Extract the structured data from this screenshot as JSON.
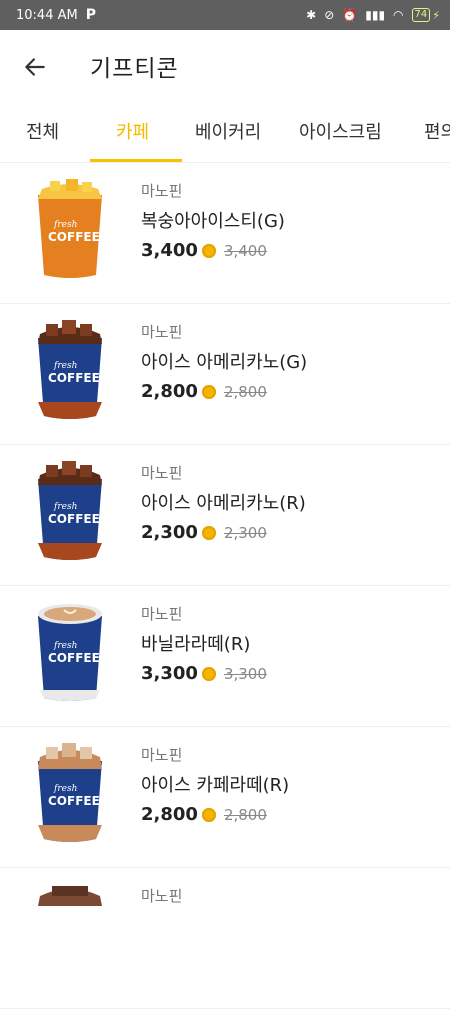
{
  "status": {
    "time": "10:44 AM",
    "app_badge": "P",
    "battery": "74"
  },
  "header": {
    "title": "기프티콘"
  },
  "tabs": [
    {
      "label": "전체"
    },
    {
      "label": "카페"
    },
    {
      "label": "베이커리"
    },
    {
      "label": "아이스크림"
    },
    {
      "label": "편의"
    }
  ],
  "items": [
    {
      "brand": "마노핀",
      "name": "복숭아아이스티(G)",
      "price": "3,400",
      "orig": "3,400",
      "drink": "peach-tea"
    },
    {
      "brand": "마노핀",
      "name": "아이스 아메리카노(G)",
      "price": "2,800",
      "orig": "2,800",
      "drink": "americano"
    },
    {
      "brand": "마노핀",
      "name": "아이스 아메리카노(R)",
      "price": "2,300",
      "orig": "2,300",
      "drink": "americano"
    },
    {
      "brand": "마노핀",
      "name": "바닐라라떼(R)",
      "price": "3,300",
      "orig": "3,300",
      "drink": "hot-latte"
    },
    {
      "brand": "마노핀",
      "name": "아이스 카페라떼(R)",
      "price": "2,800",
      "orig": "2,800",
      "drink": "iced-latte"
    },
    {
      "brand": "마노핀",
      "name": "",
      "price": "",
      "orig": "",
      "drink": "partial"
    }
  ],
  "colors": {
    "accent": "#f5c400",
    "coin": "#f4b400",
    "cup_blue": "#1e3f8a"
  }
}
